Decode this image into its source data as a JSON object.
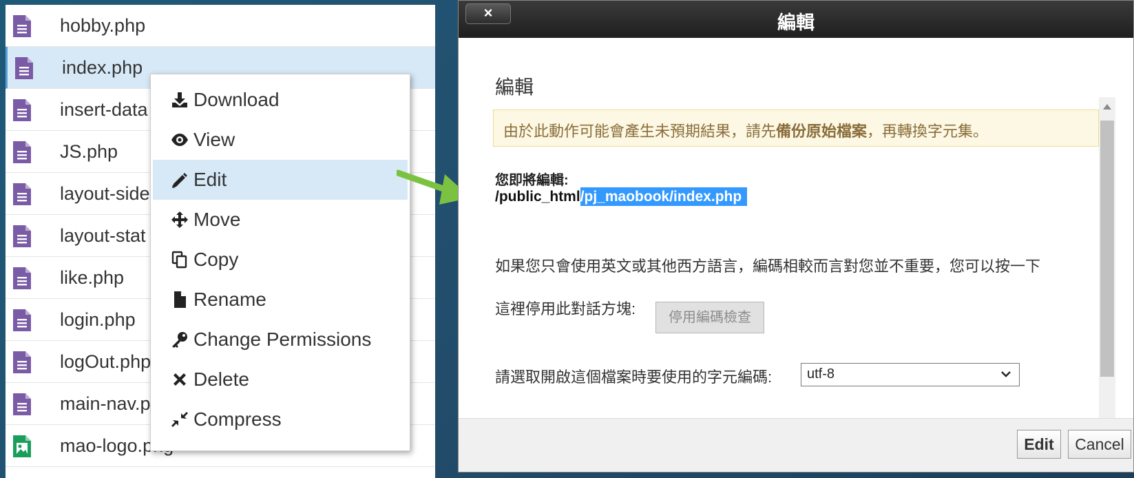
{
  "file_list": [
    {
      "name": "hobby.php",
      "icon": "php-file-icon",
      "selected": false
    },
    {
      "name": "index.php",
      "icon": "php-file-icon",
      "selected": true
    },
    {
      "name": "insert-data",
      "icon": "php-file-icon",
      "selected": false
    },
    {
      "name": "JS.php",
      "icon": "php-file-icon",
      "selected": false
    },
    {
      "name": "layout-side",
      "icon": "php-file-icon",
      "selected": false
    },
    {
      "name": "layout-stat",
      "icon": "php-file-icon",
      "selected": false
    },
    {
      "name": "like.php",
      "icon": "php-file-icon",
      "selected": false
    },
    {
      "name": "login.php",
      "icon": "php-file-icon",
      "selected": false
    },
    {
      "name": "logOut.php",
      "icon": "php-file-icon",
      "selected": false
    },
    {
      "name": "main-nav.p",
      "icon": "php-file-icon",
      "selected": false
    },
    {
      "name": "mao-logo.png",
      "icon": "image-file-icon",
      "selected": false
    }
  ],
  "context_menu": [
    {
      "label": "Download",
      "icon": "download-icon",
      "active": false
    },
    {
      "label": "View",
      "icon": "eye-icon",
      "active": false
    },
    {
      "label": "Edit",
      "icon": "pencil-icon",
      "active": true
    },
    {
      "label": "Move",
      "icon": "move-arrows-icon",
      "active": false
    },
    {
      "label": "Copy",
      "icon": "copy-icon",
      "active": false
    },
    {
      "label": "Rename",
      "icon": "file-icon",
      "active": false
    },
    {
      "label": "Change Permissions",
      "icon": "key-icon",
      "active": false
    },
    {
      "label": "Delete",
      "icon": "x-icon",
      "active": false
    },
    {
      "label": "Compress",
      "icon": "compress-icon",
      "active": false
    }
  ],
  "dialog": {
    "close_label": "×",
    "title": "編輯",
    "heading": "編輯",
    "warning_pre": "由於此動作可能會產生未預期結果，請先",
    "warning_bold": "備份原始檔案",
    "warning_post": "，再轉換字元集。",
    "editing_label": "您即將編輯:",
    "path_prefix": "/public_html",
    "path_highlight": "/pj_maobook/index.php",
    "western_note": "如果您只會使用英文或其他西方語言，編碼相較而言對您並不重要，您可以按一下",
    "disable_label": "這裡停用此對話方塊:",
    "disable_button": "停用編碼檢查",
    "encoding_label": "請選取開啟這個檔案時要使用的字元編碼:",
    "encoding_value": "utf-8",
    "edit_button": "Edit",
    "cancel_button": "Cancel"
  },
  "colors": {
    "php_icon": "#7a5ba6",
    "image_icon": "#1a9e5c",
    "arrow": "#7cc242",
    "highlight": "#3399ff",
    "selected_row": "#d7e9f7"
  }
}
